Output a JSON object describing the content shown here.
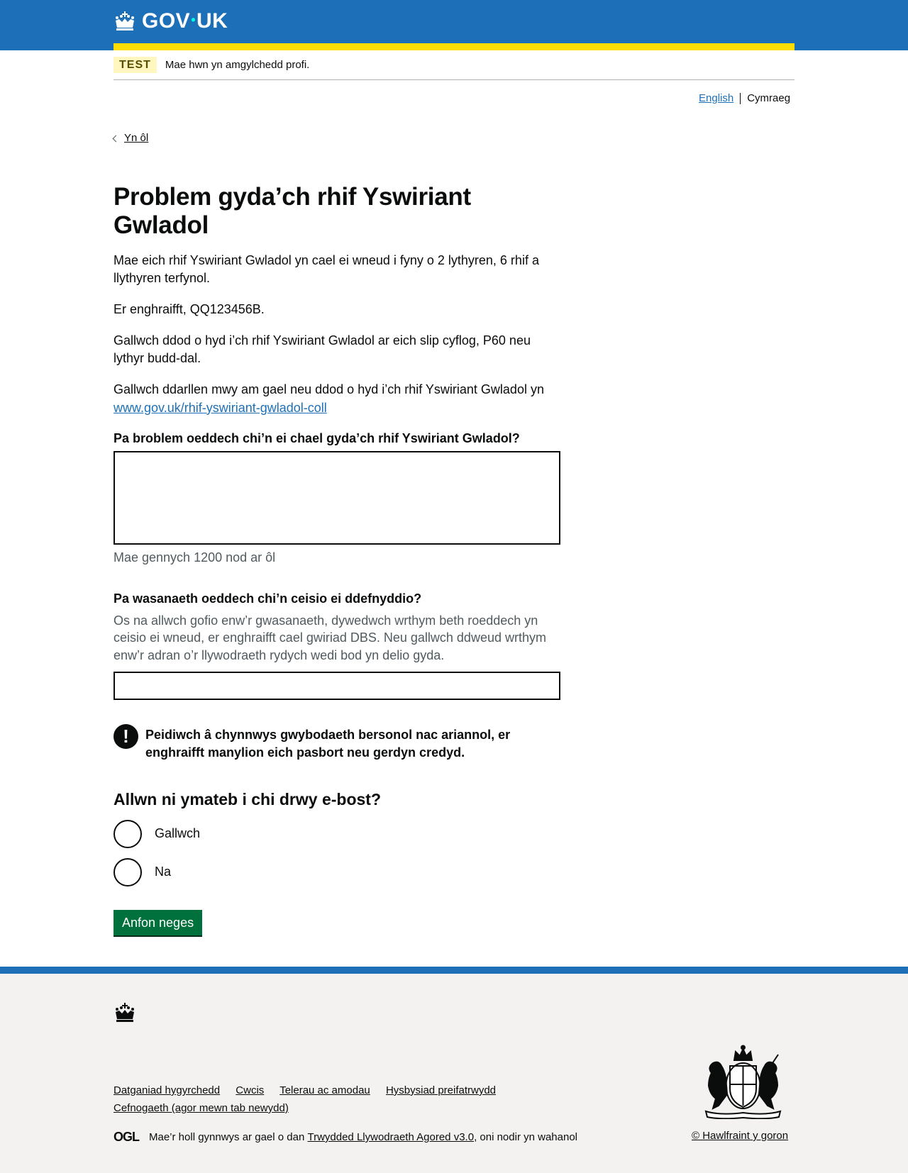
{
  "header": {
    "logo_text_left": "GOV",
    "logo_dot": "•",
    "logo_text_right": "UK",
    "logo_icon": "crown-icon",
    "brand_color": "#1d70b8",
    "accent_color": "#ffdd00"
  },
  "phase_banner": {
    "tag": "TEST",
    "text": "Mae hwn yn amgylchedd profi."
  },
  "language": {
    "english": "English",
    "welsh": "Cymraeg"
  },
  "back_link": {
    "label": "Yn ôl",
    "icon": "chevron-left-icon"
  },
  "main": {
    "title": "Problem gyda’ch rhif Yswiriant Gwladol",
    "paragraphs": [
      "Mae eich rhif Yswiriant Gwladol yn cael ei wneud i fyny o 2 lythyren, 6 rhif a llythyren terfynol.",
      "Er enghraifft, QQ123456B.",
      "Gallwch ddod o hyd i’ch rhif Yswiriant Gwladol ar eich slip cyflog, P60 neu lythyr budd-dal.",
      "Gallwch ddarllen mwy am gael neu ddod o hyd i’ch rhif Yswiriant Gwladol yn"
    ],
    "more_info_link": "www.gov.uk/rhif-yswiriant-gwladol-coll",
    "problem_field": {
      "label": "Pa broblem oeddech chi’n ei chael gyda’ch rhif Yswiriant Gwladol?",
      "value": "",
      "character_count": "Mae gennych 1200 nod ar ôl"
    },
    "service_field": {
      "label": "Pa wasanaeth oeddech chi’n ceisio ei ddefnyddio?",
      "hint": "Os na allwch gofio enw’r gwasanaeth, dywedwch wrthym beth roeddech yn ceisio ei wneud, er enghraifft cael gwiriad DBS. Neu gallwch ddweud wrthym enw’r adran o’r llywodraeth rydych wedi bod yn delio gyda.",
      "value": ""
    },
    "warning": {
      "icon_symbol": "!",
      "icon": "warning-icon",
      "text": "Peidiwch â chynnwys gwybodaeth bersonol nac ariannol, er enghraifft manylion eich pasbort neu gerdyn credyd."
    },
    "reply_question": {
      "heading": "Allwn ni ymateb i chi drwy e-bost?",
      "options": [
        "Gallwch",
        "Na"
      ]
    },
    "submit_label": "Anfon neges",
    "submit_color": "#00703c"
  },
  "footer": {
    "links": [
      "Datganiad hygyrchedd",
      "Cwcis",
      "Telerau ac amodau",
      "Hysbysiad preifatrwydd",
      "Cefnogaeth (agor mewn tab newydd)"
    ],
    "ogl_logo": "OGL",
    "licence_prefix": "Mae’r holl gynnwys ar gael o dan",
    "licence_link": "Trwydded Llywodraeth Agored v3.0",
    "licence_suffix": ", oni nodir yn wahanol",
    "copyright": "© Hawlfraint y goron",
    "crest_icon": "royal-coat-of-arms-icon",
    "crest_motto": "DIEU ET MON DROIT"
  }
}
